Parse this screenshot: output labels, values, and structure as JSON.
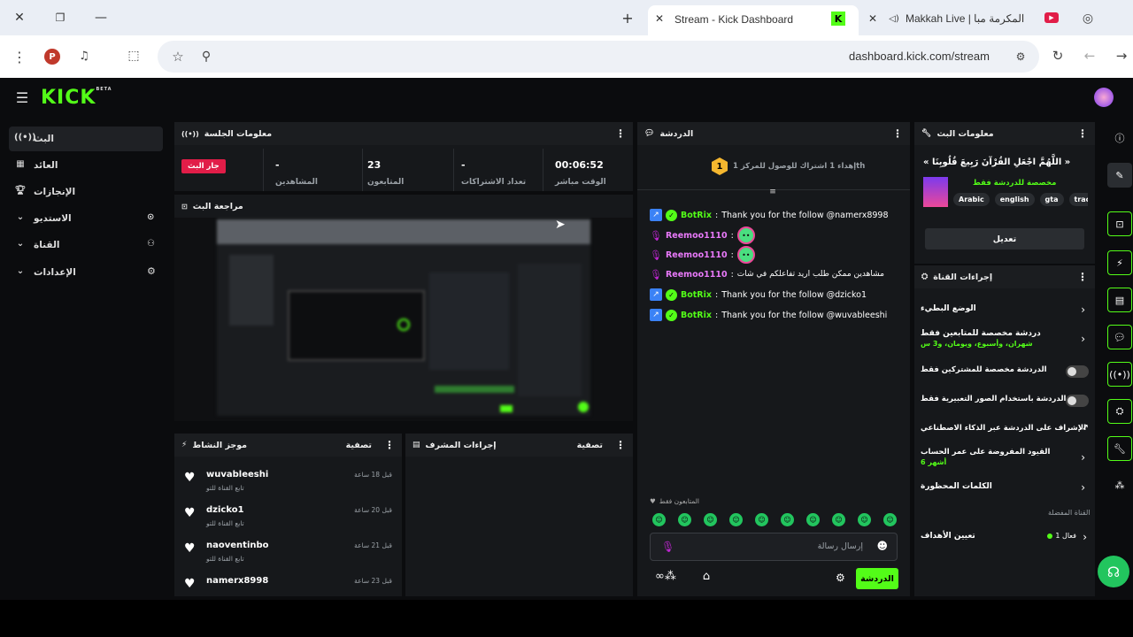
{
  "browser": {
    "tab_active_title": "Stream - Kick Dashboard",
    "tab2_title": "Makkah Live | المكرمة مبا",
    "url": "dashboard.kick.com/stream",
    "profile_initial": "P"
  },
  "brand": {
    "logo": "KICK",
    "beta": "BETA"
  },
  "sidebar": {
    "items": [
      {
        "label": "البث"
      },
      {
        "label": "العائد"
      },
      {
        "label": "الإنجازات"
      },
      {
        "label": "الاستديو"
      },
      {
        "label": "القناة"
      },
      {
        "label": "الإعدادات"
      }
    ]
  },
  "session": {
    "title": "معلومات الجلسة",
    "live_badge": "جار البث",
    "stats": [
      {
        "value": "-",
        "label": "المشاهدين"
      },
      {
        "value": "23",
        "label": "المتابعون"
      },
      {
        "value": "-",
        "label": "تعداد الاشتراكات"
      },
      {
        "value": "00:06:52",
        "label": "الوقت مباشر"
      }
    ]
  },
  "preview": {
    "title": "مراجعة البث"
  },
  "chat": {
    "title": "الدردشة",
    "goal_badge": "1",
    "goal_text": "إهداء 1 اشتراك للوصول للمركز 1th",
    "messages": [
      {
        "user": "BotRix",
        "text": "Thank you for the follow @namerx8998",
        "type": "bot"
      },
      {
        "user": "Reemoo1110",
        "text": "",
        "type": "emote"
      },
      {
        "user": "Reemoo1110",
        "text": "",
        "type": "emote"
      },
      {
        "user": "Reemoo1110",
        "text": "مشاهدين ممكن طلب اريد تفاعلكم في شات",
        "type": "text"
      },
      {
        "user": "BotRix",
        "text": "Thank you for the follow @dzicko1",
        "type": "bot"
      },
      {
        "user": "BotRix",
        "text": "Thank you for the follow @wuvableeshi",
        "type": "bot"
      }
    ],
    "followers_only": "المتابعون فقط",
    "input_placeholder": "إرسال رسالة",
    "send_label": "الدردشة"
  },
  "stream_info": {
    "title": "معلومات البث",
    "stream_title": "« اللَّهُمَّ اجْعَلِ القُرْآنَ رَبِيعَ قُلُوبِنَا »",
    "category": "مخصصة للدردشة فقط",
    "tags": [
      "Arabic",
      "english",
      "gta",
      "trac"
    ],
    "edit_label": "تعديل"
  },
  "channel_actions": {
    "title": "إجراءات القناة",
    "items": [
      {
        "label": "الوضع البطيء",
        "sub": ""
      },
      {
        "label": "دردشة مخصصة للمتابعين فقط",
        "sub": "شهران، وأسبوع، ويومان، و3 س"
      },
      {
        "label": "الدردشة مخصصة للمشتركين فقط",
        "sub": ""
      },
      {
        "label": "الدردشة باستخدام الصور التعبيرية فقط",
        "sub": ""
      },
      {
        "label": "الإشراف على الدردشة عبر الذكاء الاصطناعي",
        "sub": ""
      },
      {
        "label": "القيود المفروضة على عمر الحساب",
        "sub": "أشهر 6"
      },
      {
        "label": "الكلمات المحظورة",
        "sub": ""
      }
    ],
    "fav_label": "القناة المفضلة",
    "goals_label": "تعيين الأهداف",
    "goals_count": "فعال 1"
  },
  "activity": {
    "title": "موجز النشاط",
    "filter": "تصفية",
    "rows": [
      {
        "user": "wuvableeshi",
        "sub": "تابع القناة للتو",
        "time": "قبل 18 ساعة"
      },
      {
        "user": "dzicko1",
        "sub": "تابع القناة للتو",
        "time": "قبل 20 ساعة"
      },
      {
        "user": "naoventinbo",
        "sub": "تابع القناة للتو",
        "time": "قبل 21 ساعة"
      },
      {
        "user": "namerx8998",
        "sub": "",
        "time": "قبل 23 ساعة"
      }
    ]
  },
  "mod_actions": {
    "title": "إجراءات المشرف",
    "filter": "تصفية"
  },
  "colors": {
    "accent": "#53fc18",
    "live": "#e11d48"
  }
}
